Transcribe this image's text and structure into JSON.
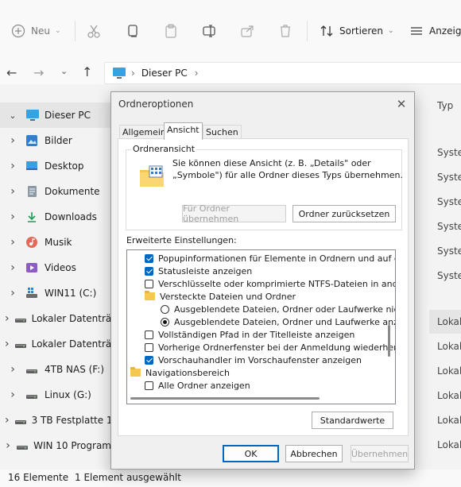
{
  "toolbar": {
    "new_label": "Neu",
    "sort_label": "Sortieren",
    "view_label": "Anzeigen"
  },
  "address": {
    "location": "Dieser PC"
  },
  "nav": {
    "items": [
      {
        "label": "Dieser PC",
        "icon": "monitor-icon"
      },
      {
        "label": "Bilder",
        "icon": "pictures-icon"
      },
      {
        "label": "Desktop",
        "icon": "desktop-icon"
      },
      {
        "label": "Dokumente",
        "icon": "documents-icon"
      },
      {
        "label": "Downloads",
        "icon": "download-icon"
      },
      {
        "label": "Musik",
        "icon": "music-icon"
      },
      {
        "label": "Videos",
        "icon": "videos-icon"
      },
      {
        "label": "WIN11 (C:)",
        "icon": "windows-drive-icon"
      },
      {
        "label": "Lokaler Datenträ",
        "icon": "drive-icon"
      },
      {
        "label": "Lokaler Datenträ",
        "icon": "drive-icon"
      },
      {
        "label": "4TB NAS (F:)",
        "icon": "drive-icon"
      },
      {
        "label": "Linux (G:)",
        "icon": "drive-icon"
      },
      {
        "label": "3 TB Festplatte 1",
        "icon": "drive-icon"
      },
      {
        "label": "WIN 10 Program",
        "icon": "drive-icon"
      }
    ]
  },
  "list": {
    "col_type": "Typ",
    "types": [
      "Syster",
      "Syster",
      "Syster",
      "Syster",
      "Syster",
      "Syster",
      "Lokal",
      "Lokal",
      "Lokal",
      "Lokal",
      "Lokal",
      "Lokal"
    ]
  },
  "status": {
    "count": "16 Elemente",
    "selected": "1 Element ausgewählt"
  },
  "dialog": {
    "title": "Ordneroptionen",
    "tabs": [
      "Allgemein",
      "Ansicht",
      "Suchen"
    ],
    "group_title": "Ordneransicht",
    "group_text_1": "Sie können diese Ansicht (z. B. „Details\" oder",
    "group_text_2": "„Symbole\") für alle Ordner dieses Typs übernehmen.",
    "apply_folders": "Für Ordner übernehmen",
    "reset_folders": "Ordner zurücksetzen",
    "advanced_label": "Erweiterte Einstellungen:",
    "settings": [
      {
        "kind": "checkbox",
        "checked": true,
        "label": "Popupinformationen für Elemente in Ordnern und auf dem D"
      },
      {
        "kind": "checkbox",
        "checked": true,
        "label": "Statusleiste anzeigen"
      },
      {
        "kind": "checkbox",
        "checked": false,
        "label": "Verschlüsselte oder komprimierte NTFS-Dateien in anderer"
      },
      {
        "kind": "folder",
        "label": "Versteckte Dateien und Ordner"
      },
      {
        "kind": "radio",
        "checked": false,
        "label": "Ausgeblendete Dateien, Ordner oder Laufwerke nicht a"
      },
      {
        "kind": "radio",
        "checked": true,
        "label": "Ausgeblendete Dateien, Ordner und Laufwerke anzeig"
      },
      {
        "kind": "checkbox",
        "checked": false,
        "label": "Vollständigen Pfad in der Titelleiste anzeigen"
      },
      {
        "kind": "checkbox",
        "checked": false,
        "label": "Vorherige Ordnerfenster bei der Anmeldung wiederherstellen"
      },
      {
        "kind": "checkbox",
        "checked": true,
        "label": "Vorschauhandler im Vorschaufenster anzeigen"
      },
      {
        "kind": "folder-root",
        "label": "Navigationsbereich"
      },
      {
        "kind": "checkbox",
        "checked": false,
        "label": "Alle Ordner anzeigen"
      }
    ],
    "defaults": "Standardwerte",
    "ok": "OK",
    "cancel": "Abbrechen",
    "apply": "Übernehmen"
  },
  "colors": {
    "accent": "#0067c0",
    "dialog_bg": "#f0f0f0",
    "folder": "#f6c851"
  }
}
